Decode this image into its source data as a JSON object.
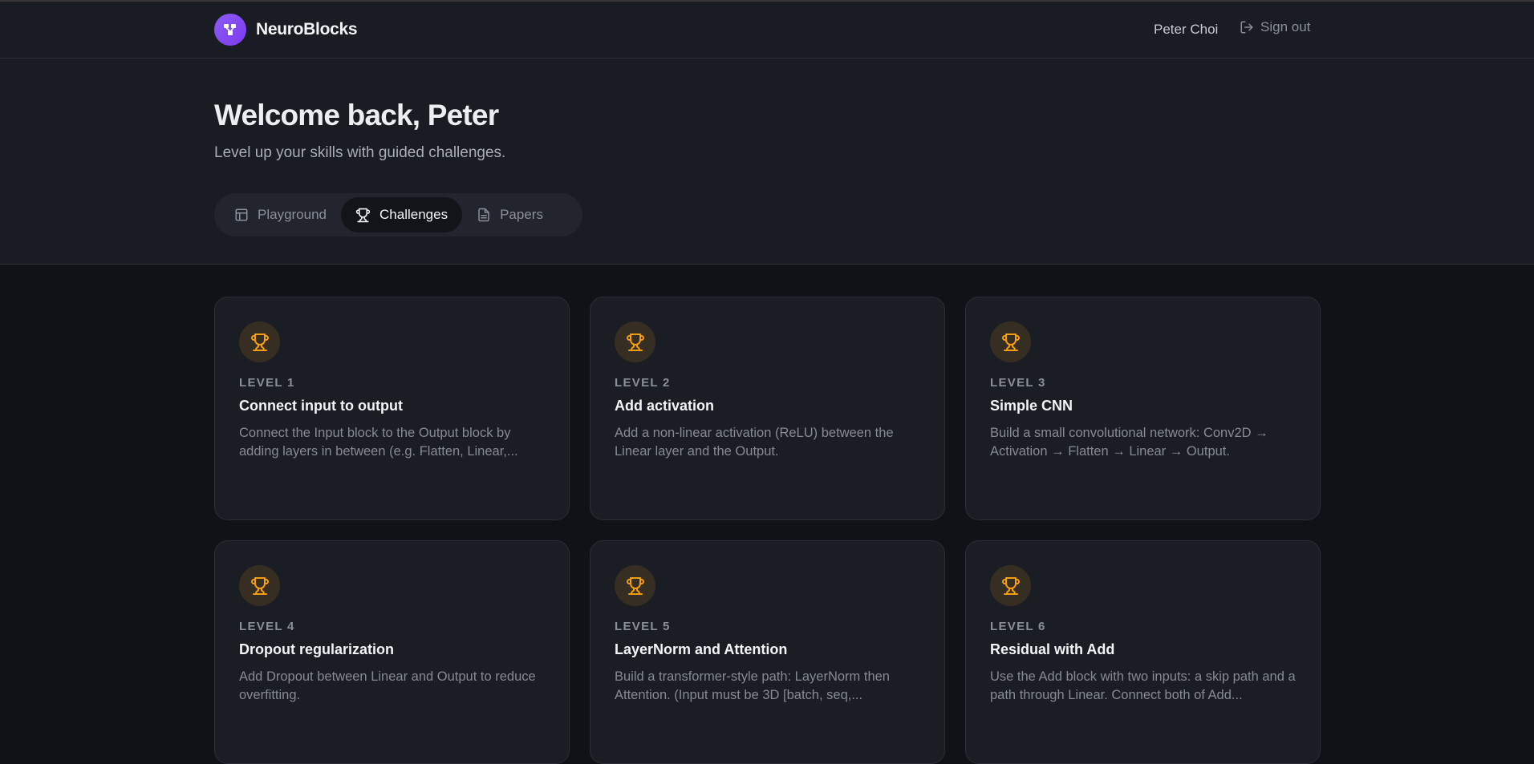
{
  "header": {
    "app_name": "NeuroBlocks",
    "user_name": "Peter Choi",
    "signout_label": "Sign out"
  },
  "hero": {
    "title": "Welcome back, Peter",
    "subtitle": "Level up your skills with guided challenges."
  },
  "tabs": [
    {
      "label": "Playground",
      "icon": "layout-icon",
      "active": false
    },
    {
      "label": "Challenges",
      "icon": "trophy-icon",
      "active": true
    },
    {
      "label": "Papers",
      "icon": "document-icon",
      "active": false
    }
  ],
  "challenges": [
    {
      "level": "LEVEL 1",
      "title": "Connect input to output",
      "description": "Connect the Input block to the Output block by adding layers in between (e.g. Flatten, Linear,..."
    },
    {
      "level": "LEVEL 2",
      "title": "Add activation",
      "description": "Add a non-linear activation (ReLU) between the Linear layer and the Output."
    },
    {
      "level": "LEVEL 3",
      "title": "Simple CNN",
      "description": "Build a small convolutional network: Conv2D → Activation → Flatten → Linear → Output."
    },
    {
      "level": "LEVEL 4",
      "title": "Dropout regularization",
      "description": "Add Dropout between Linear and Output to reduce overfitting."
    },
    {
      "level": "LEVEL 5",
      "title": "LayerNorm and Attention",
      "description": "Build a transformer-style path: LayerNorm then Attention. (Input must be 3D [batch, seq,..."
    },
    {
      "level": "LEVEL 6",
      "title": "Residual with Add",
      "description": "Use the Add block with two inputs: a skip path and a path through Linear. Connect both of Add..."
    }
  ],
  "colors": {
    "accent": "#8b5cf6",
    "trophy": "#f59e0b",
    "background": "#111217",
    "surface": "#1a1c23"
  }
}
